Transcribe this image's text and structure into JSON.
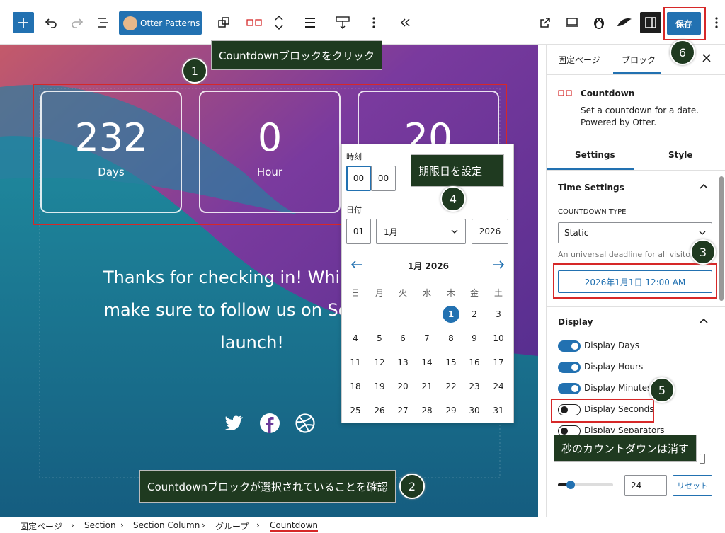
{
  "toolbar": {
    "otter_patterns": "Otter Patterns",
    "save": "保存"
  },
  "canvas": {
    "countdown": [
      {
        "value": "232",
        "label": "Days"
      },
      {
        "value": "0",
        "label": "Hour"
      },
      {
        "value": "20",
        "label": ""
      }
    ],
    "paragraph_lines": [
      "Thanks for checking in! While we a",
      "make sure to follow us on Social to",
      "launch!"
    ]
  },
  "picker": {
    "time_label": "時刻",
    "hour": "00",
    "minute": "00",
    "date_label": "日付",
    "day": "01",
    "month": "1月",
    "year": "2026",
    "month_title": "1月 2026",
    "weekdays": [
      "日",
      "月",
      "火",
      "水",
      "木",
      "金",
      "土"
    ],
    "weeks": [
      [
        "",
        "",
        "",
        "",
        "1",
        "2",
        "3"
      ],
      [
        "4",
        "5",
        "6",
        "7",
        "8",
        "9",
        "10"
      ],
      [
        "11",
        "12",
        "13",
        "14",
        "15",
        "16",
        "17"
      ],
      [
        "18",
        "19",
        "20",
        "21",
        "22",
        "23",
        "24"
      ],
      [
        "25",
        "26",
        "27",
        "28",
        "29",
        "30",
        "31"
      ]
    ],
    "selected_day": "1"
  },
  "sidebar": {
    "tab_page": "固定ページ",
    "tab_block": "ブロック",
    "block_name": "Countdown",
    "block_desc_1": "Set a countdown for a date.",
    "block_desc_2": "Powered by Otter.",
    "subtab_settings": "Settings",
    "subtab_style": "Style",
    "time_settings": "Time Settings",
    "countdown_type_label": "COUNTDOWN TYPE",
    "countdown_type_value": "Static",
    "countdown_help": "An universal deadline for all visitors",
    "date_button": "2026年1月1日 12:00 AM",
    "display_title": "Display",
    "toggles": [
      {
        "label": "Display Days",
        "on": true
      },
      {
        "label": "Display Hours",
        "on": true
      },
      {
        "label": "Display Minutes",
        "on": true
      },
      {
        "label": "Display Seconds",
        "on": false
      },
      {
        "label": "Display Separators",
        "on": false
      }
    ],
    "range_value": "24",
    "reset": "リセット"
  },
  "annotations": {
    "n1": "Countdownブロックをクリック",
    "n2": "Countdownブロックが選択されていることを確認",
    "n4": "期限日を設定",
    "n5": "秒のカウントダウンは消す",
    "c1": "1",
    "c2": "2",
    "c3": "3",
    "c4": "4",
    "c5": "5",
    "c6": "6"
  },
  "breadcrumb": [
    "固定ページ",
    "Section",
    "Section Column",
    "グループ",
    "Countdown"
  ]
}
